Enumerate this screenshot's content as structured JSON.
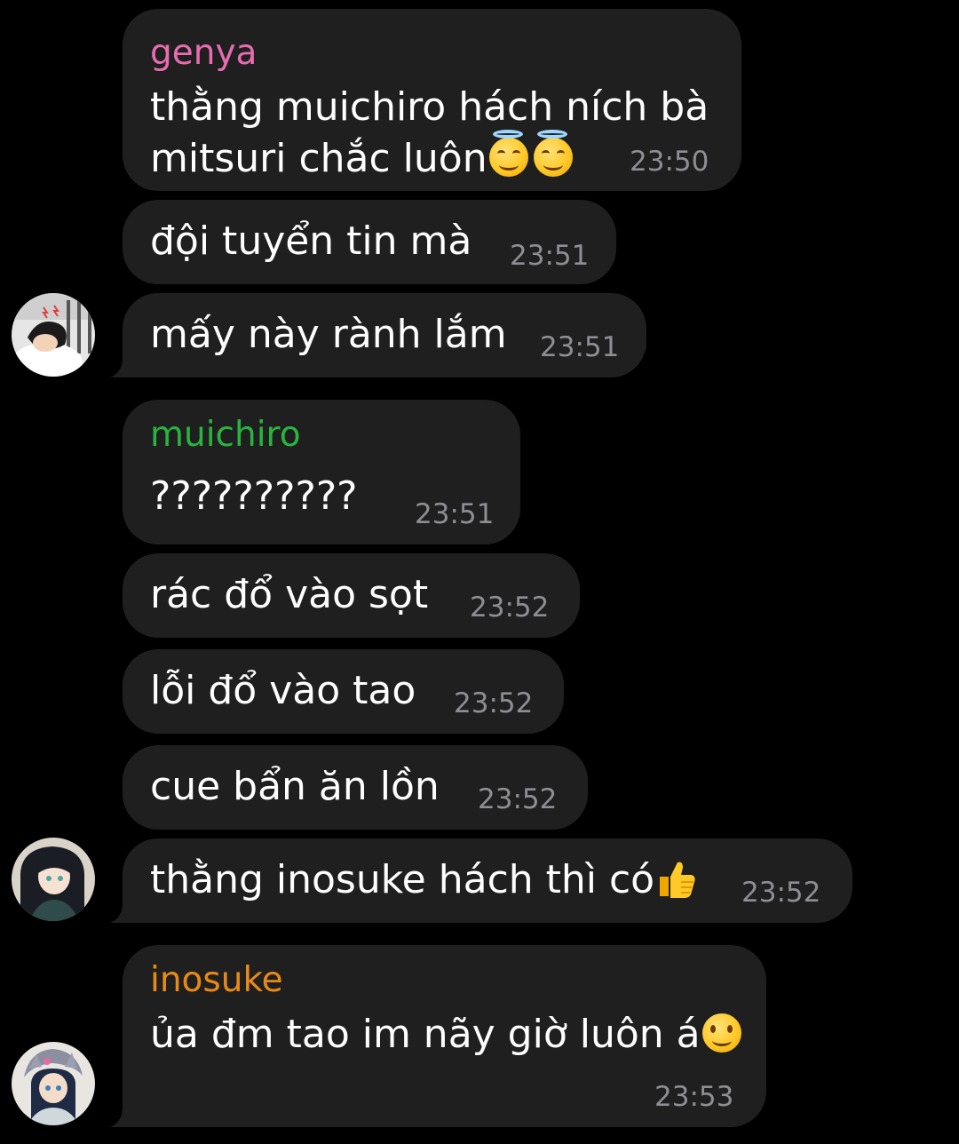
{
  "messages": [
    {
      "sender": "genya",
      "text": "thằng muichiro hách ních bà\nmitsuri chắc luôn",
      "emoji": "smiling-face-with-halo-emoji x2",
      "time": "23:50"
    },
    {
      "text": "đội tuyển tin mà",
      "time": "23:51"
    },
    {
      "text": "mấy này rành lắm",
      "time": "23:51"
    },
    {
      "sender": "muichiro",
      "text": "??????????",
      "time": "23:51"
    },
    {
      "text": "rác đổ vào sọt",
      "time": "23:52"
    },
    {
      "text": "lỗi đổ vào tao",
      "time": "23:52"
    },
    {
      "text": "cue bẩn ăn lồn",
      "time": "23:52"
    },
    {
      "text": "thằng inosuke hách thì có",
      "emoji": "thumbs-up-emoji",
      "time": "23:52"
    },
    {
      "sender": "inosuke",
      "text": "ủa đm tao im nãy giờ luôn á",
      "emoji": "slightly-smiling-face-emoji",
      "time": "23:53"
    }
  ],
  "colors": {
    "background": "#000000",
    "bubble": "#1f1f1f",
    "text": "#ffffff",
    "time": "#8e8e93",
    "genya": "#e86cb0",
    "muichiro": "#27b43f",
    "inosuke": "#e98a17"
  },
  "avatars": [
    "genya-avatar",
    "muichiro-avatar",
    "inosuke-avatar"
  ]
}
